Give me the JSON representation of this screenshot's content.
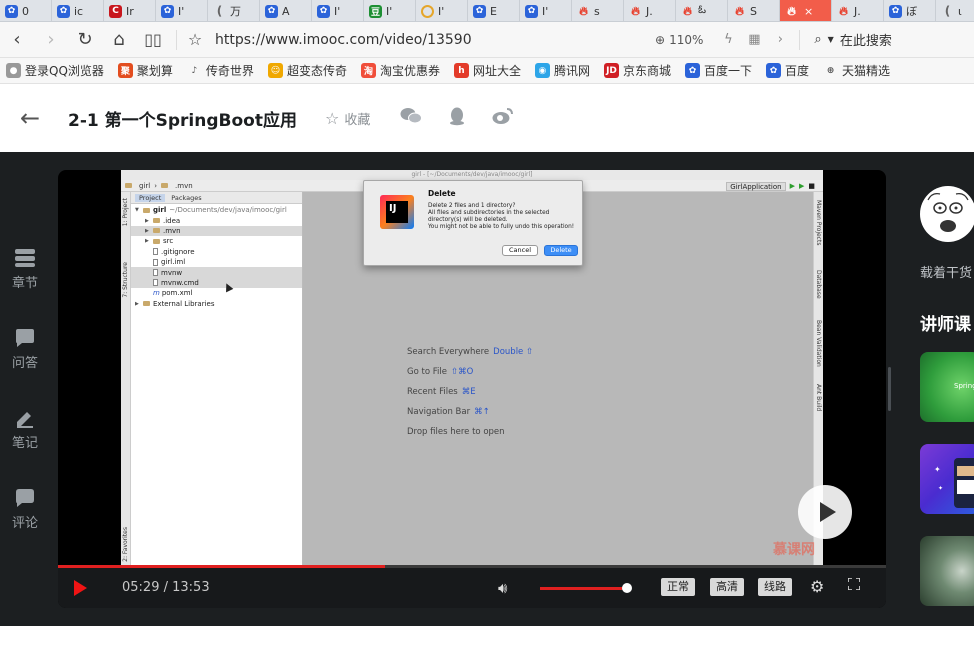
{
  "browser": {
    "tabs": [
      {
        "icon": "paw",
        "label": "0"
      },
      {
        "icon": "paw",
        "label": "ic"
      },
      {
        "icon": "c",
        "label": "Ir"
      },
      {
        "icon": "paw",
        "label": "I'"
      },
      {
        "icon": "gray",
        "label": "万"
      },
      {
        "icon": "paw",
        "label": "A"
      },
      {
        "icon": "paw",
        "label": "I'"
      },
      {
        "icon": "dou",
        "label": "I'"
      },
      {
        "icon": "ring",
        "label": "I'"
      },
      {
        "icon": "paw",
        "label": "E"
      },
      {
        "icon": "paw",
        "label": "I'"
      },
      {
        "icon": "flame",
        "label": "s"
      },
      {
        "icon": "flame",
        "label": "J."
      },
      {
        "icon": "flame",
        "label": "ఓ"
      },
      {
        "icon": "flame",
        "label": "S"
      },
      {
        "icon": "flame",
        "label": "×",
        "active": true
      },
      {
        "icon": "flame",
        "label": "J."
      },
      {
        "icon": "paw",
        "label": "ぼ"
      },
      {
        "icon": "gray",
        "label": "ι"
      }
    ],
    "url": "https://www.imooc.com/video/13590",
    "zoom": "110%",
    "search_label": "在此搜索",
    "bookmarks": [
      {
        "icon": "person",
        "label": "登录QQ浏览器"
      },
      {
        "icon": "ju",
        "label": "聚划算"
      },
      {
        "icon": "cq",
        "label": "传奇世界"
      },
      {
        "icon": "smile",
        "label": "超变态传奇"
      },
      {
        "icon": "bag",
        "label": "淘宝优惠券"
      },
      {
        "icon": "hao",
        "label": "网址大全"
      },
      {
        "icon": "tx",
        "label": "腾讯网"
      },
      {
        "icon": "jd",
        "label": "京东商城"
      },
      {
        "icon": "paw",
        "label": "百度一下"
      },
      {
        "icon": "paw",
        "label": "百度"
      },
      {
        "icon": "globe",
        "label": "天猫精选"
      }
    ]
  },
  "header": {
    "title": "2-1 第一个SpringBoot应用",
    "favorite_label": "收藏"
  },
  "sidebar": {
    "items": [
      {
        "label": "章节"
      },
      {
        "label": "问答"
      },
      {
        "label": "笔记"
      },
      {
        "label": "评论"
      }
    ]
  },
  "video": {
    "ide": {
      "window_title": "girl - [~/Documents/dev/java/imooc/girl]",
      "breadcrumb": [
        "girl",
        ".mvn"
      ],
      "run_config": "GirlApplication",
      "project_tabs": [
        "Project",
        "Packages"
      ],
      "left_tools": [
        "1: Project",
        "7: Structure",
        "2: Favorites"
      ],
      "right_tools": [
        "Maven Projects",
        "Database",
        "Bean Validation",
        "Ant Build"
      ],
      "tree": [
        {
          "indent": 0,
          "type": "folder",
          "label": "girl",
          "extra": "~/Documents/dev/java/imooc/girl",
          "caret": "▼",
          "bold": true
        },
        {
          "indent": 1,
          "type": "folder",
          "label": ".idea",
          "caret": "▶"
        },
        {
          "indent": 1,
          "type": "folder",
          "label": ".mvn",
          "caret": "▶",
          "hl": true
        },
        {
          "indent": 1,
          "type": "folder",
          "label": "src",
          "caret": "▶"
        },
        {
          "indent": 1,
          "type": "file",
          "label": ".gitignore"
        },
        {
          "indent": 1,
          "type": "file",
          "label": "girl.iml"
        },
        {
          "indent": 1,
          "type": "file",
          "label": "mvnw",
          "hl": true
        },
        {
          "indent": 1,
          "type": "file",
          "label": "mvnw.cmd",
          "hl": true
        },
        {
          "indent": 1,
          "type": "file",
          "label": "pom.xml",
          "prefix": "m"
        },
        {
          "indent": 0,
          "type": "lib",
          "label": "External Libraries",
          "caret": "▶"
        }
      ],
      "hints": [
        {
          "text": "Search Everywhere",
          "key": "Double ⇧"
        },
        {
          "text": "Go to File",
          "key": "⇧⌘O"
        },
        {
          "text": "Recent Files",
          "key": "⌘E"
        },
        {
          "text": "Navigation Bar",
          "key": "⌘↑"
        },
        {
          "text": "Drop files here to open",
          "key": ""
        }
      ],
      "dialog": {
        "logo_text": "IJ",
        "title": "Delete",
        "lines": [
          "Delete 2 files and 1 directory?",
          "All files and subdirectories in the selected",
          "directory(s) will be deleted.",
          "You might not be able to fully undo this operation!"
        ],
        "cancel": "Cancel",
        "delete": "Delete"
      }
    },
    "watermark": "慕课网",
    "current_time": "05:29",
    "total_time": "13:53",
    "time_sep": " / ",
    "progress": 0.395,
    "volume": 0.93,
    "controls": {
      "quality": "正常",
      "hd": "高清",
      "route": "线路"
    }
  },
  "right": {
    "teacher_text": "载着干货",
    "section_title": "讲师课",
    "course1_text": "Spring"
  },
  "colors": {
    "accent": "#f01414",
    "stage_bg": "#1c1f21",
    "active_tab": "#f25d4a"
  }
}
